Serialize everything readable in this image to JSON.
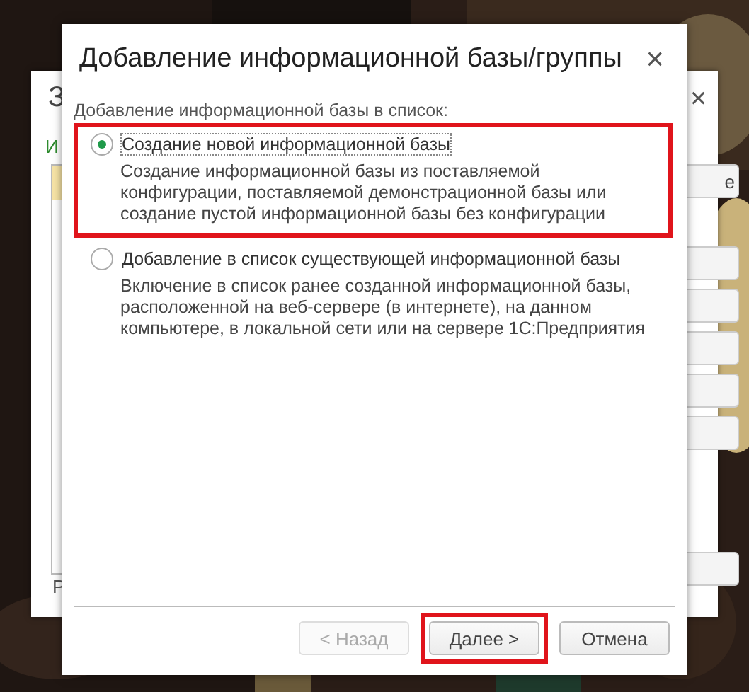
{
  "background_window": {
    "title": "З",
    "close": "×",
    "link": "И",
    "footer_label": "Р",
    "side_buttons": [
      "е"
    ]
  },
  "dialog": {
    "title": "Добавление информационной базы/группы",
    "close": "×",
    "section_label": "Добавление информационной базы в список:",
    "options": [
      {
        "label": "Создание новой информационной базы",
        "description": "Создание информационной базы из поставляемой конфигурации, поставляемой демонстрационной базы или создание пустой информационной базы без конфигурации",
        "selected": true,
        "highlighted": true
      },
      {
        "label": "Добавление в список существующей информационной базы",
        "description": "Включение в список ранее созданной информационной базы, расположенной на веб-сервере (в интернете), на данном компьютере,  в локальной сети или на сервере 1С:Предприятия",
        "selected": false,
        "highlighted": false
      }
    ],
    "buttons": [
      {
        "label": "< Назад",
        "disabled": true,
        "highlighted": false
      },
      {
        "label": "Далее >",
        "disabled": false,
        "highlighted": true
      },
      {
        "label": "Отмена",
        "disabled": false,
        "highlighted": false
      }
    ]
  }
}
